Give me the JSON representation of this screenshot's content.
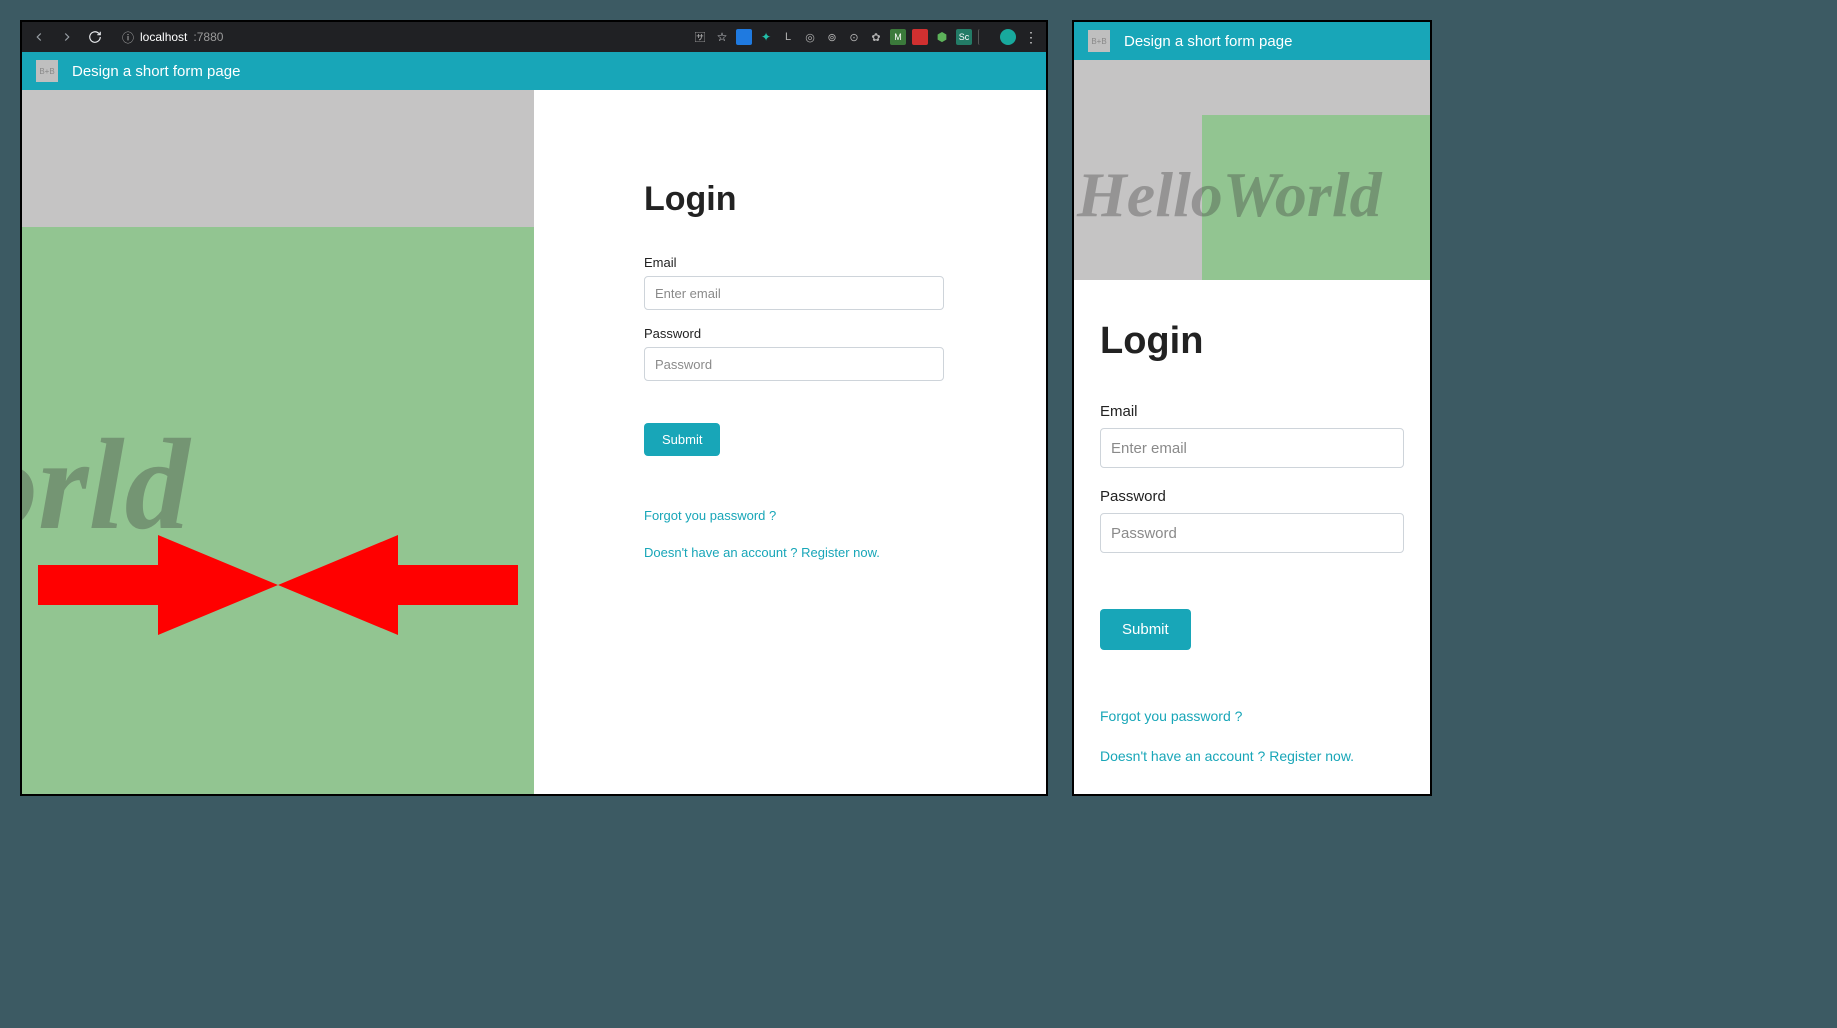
{
  "browser": {
    "url_prefix_icon": "ⓘ",
    "url_host": "localhost",
    "url_path": ":7880"
  },
  "header": {
    "logo_text": "B+B",
    "title": "Design a short form page"
  },
  "hero": {
    "text": "HelloWorld",
    "text_partial": "oWorld"
  },
  "form": {
    "title": "Login",
    "email_label": "Email",
    "email_placeholder": "Enter email",
    "password_label": "Password",
    "password_placeholder": "Password",
    "submit_label": "Submit",
    "forgot_link": "Forgot you password ?",
    "register_link": "Doesn't have an account ? Register now."
  }
}
